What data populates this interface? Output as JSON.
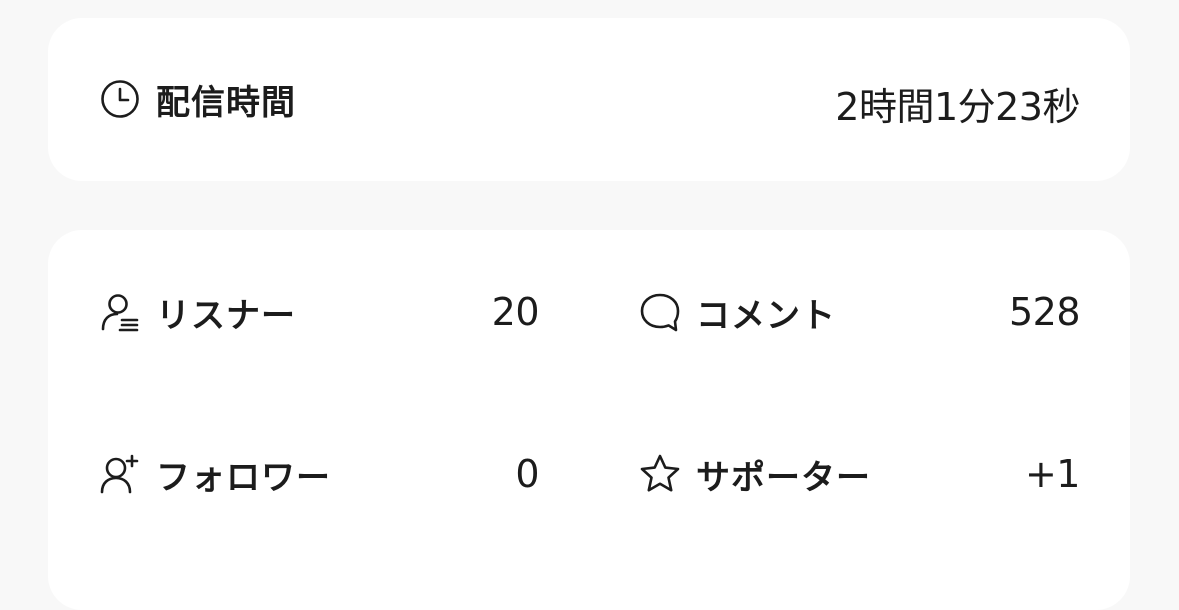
{
  "duration": {
    "icon": "clock-icon",
    "label": "配信時間",
    "value": "2時間1分23秒"
  },
  "stats": [
    {
      "key": "listeners",
      "icon": "listener-icon",
      "label": "リスナー",
      "value": "20"
    },
    {
      "key": "comments",
      "icon": "comment-bubble-icon",
      "label": "コメント",
      "value": "528"
    },
    {
      "key": "followers",
      "icon": "user-plus-icon",
      "label": "フォロワー",
      "value": "0"
    },
    {
      "key": "supporters",
      "icon": "star-icon",
      "label": "サポーター",
      "value": "+1"
    }
  ]
}
